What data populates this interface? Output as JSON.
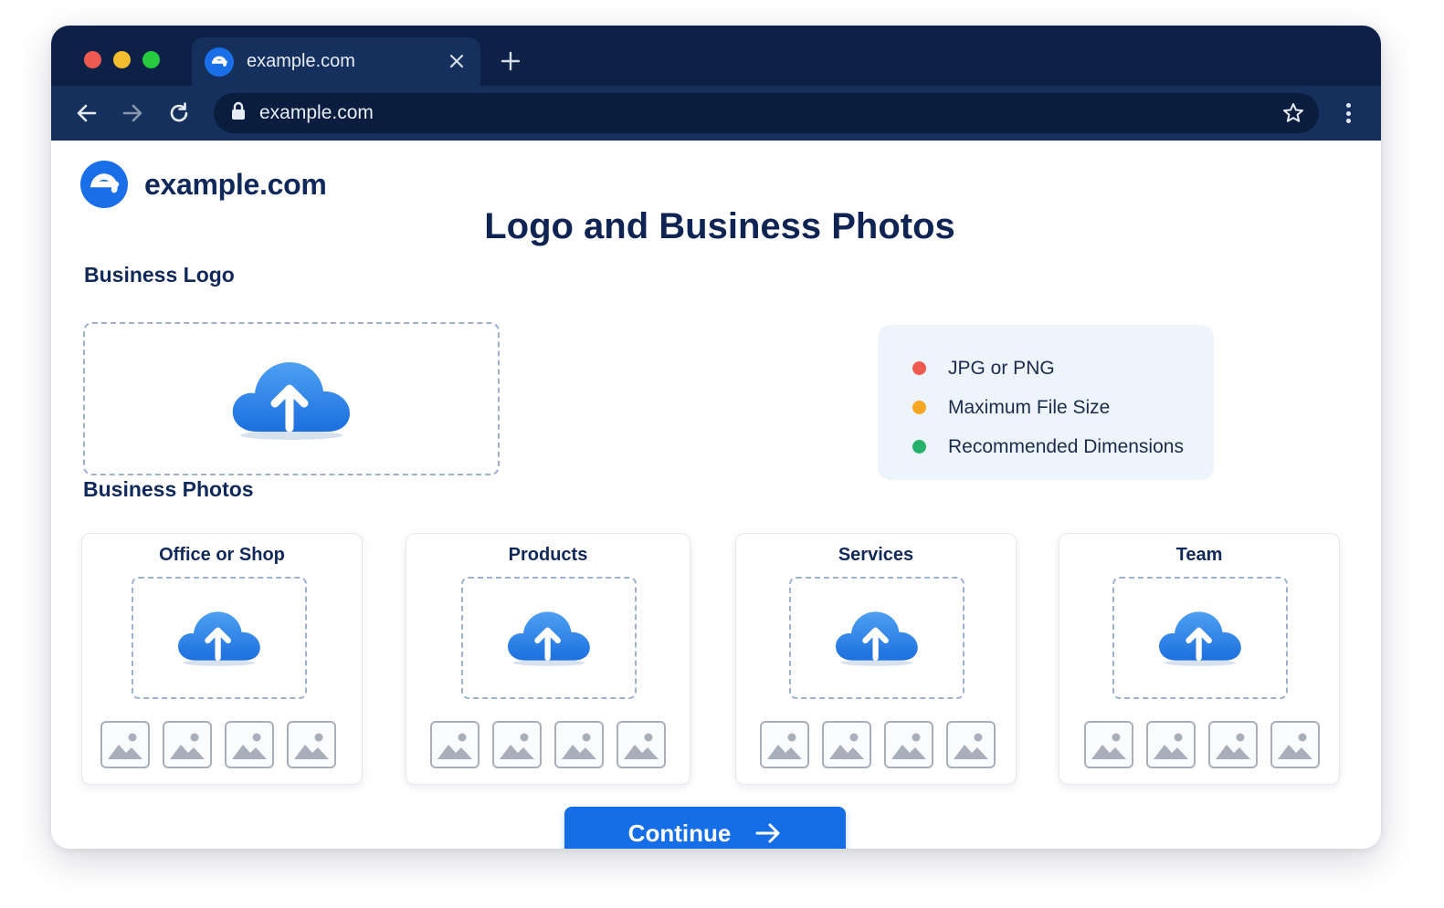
{
  "browser": {
    "tab_title": "example.com",
    "address_url": "example.com",
    "icons": {
      "favicon": "e-logo-icon",
      "close": "close-icon",
      "new_tab": "plus-icon",
      "back": "arrow-left-icon",
      "forward": "arrow-right-icon",
      "reload": "reload-icon",
      "lock": "lock-icon",
      "bookmark": "star-icon",
      "menu": "kebab-menu-icon"
    }
  },
  "colors": {
    "chrome_dark": "#0d2146",
    "brand_blue": "#1a6fe8",
    "button_blue": "#166ee6",
    "title_navy": "#0f2452"
  },
  "site": {
    "brand_name": "example.com"
  },
  "page": {
    "title": "Logo and Business Photos",
    "logo_section_label": "Business Logo",
    "photos_section_label": "Business Photos"
  },
  "requirements": [
    {
      "label": "JPG or PNG",
      "color": "#ee5a4f"
    },
    {
      "label": "Maximum File Size",
      "color": "#f5a623"
    },
    {
      "label": "Recommended Dimensions",
      "color": "#27b06b"
    }
  ],
  "photo_categories": [
    {
      "title": "Office or Shop",
      "thumb_count": 4
    },
    {
      "title": "Products",
      "thumb_count": 4
    },
    {
      "title": "Services",
      "thumb_count": 4
    },
    {
      "title": "Team",
      "thumb_count": 4
    }
  ],
  "continue_label": "Continue"
}
